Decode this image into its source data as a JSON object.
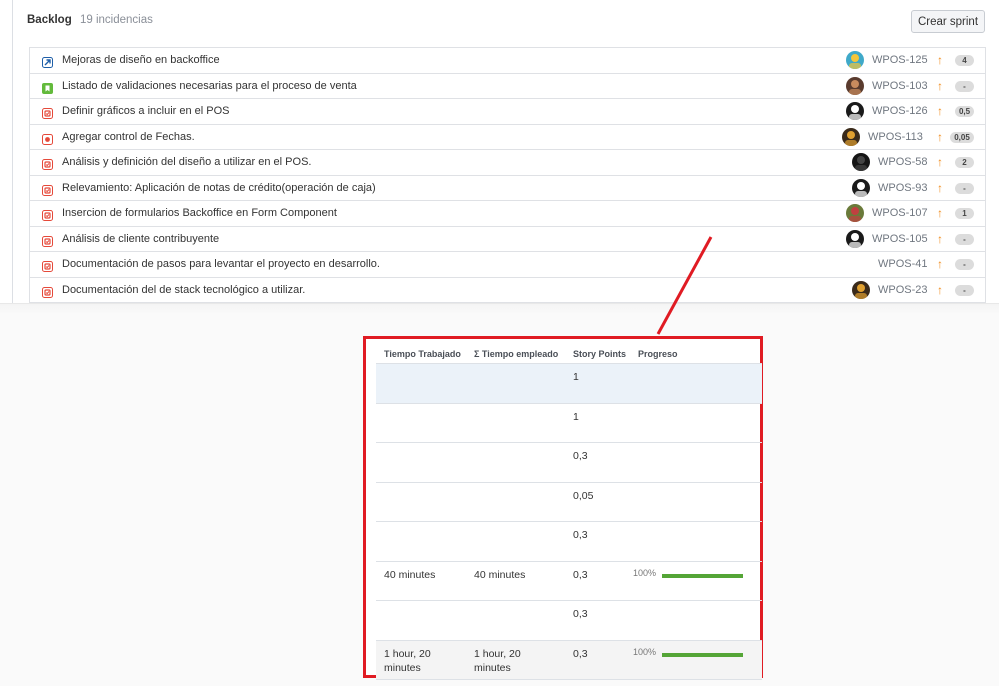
{
  "backlog": {
    "title": "Backlog",
    "count": "19 incidencias",
    "create_sprint_label": "Crear sprint"
  },
  "issues": [
    {
      "type": "improvement-icon",
      "summary": "Mejoras de diseño en backoffice",
      "key": "WPOS-125",
      "estimate": "4",
      "avatar_color": "#3fa9c9",
      "avatar_accent": "#f4c63a"
    },
    {
      "type": "story-icon",
      "summary": "Listado de validaciones necesarias para el proceso de venta",
      "key": "WPOS-103",
      "estimate": "-",
      "avatar_color": "#5a3b2e",
      "avatar_accent": "#c98b5e"
    },
    {
      "type": "task-icon",
      "summary": "Definir gráficos a incluir en el POS",
      "key": "WPOS-126",
      "estimate": "0,5",
      "avatar_color": "#1a1a1a",
      "avatar_accent": "#ffffff"
    },
    {
      "type": "bug-icon",
      "summary": "Agregar control de Fechas.",
      "key": "WPOS-113",
      "estimate": "0,05",
      "avatar_color": "#3a2a1a",
      "avatar_accent": "#e0a030"
    },
    {
      "type": "task-icon",
      "summary": "Análisis y definición del diseño a utilizar en el POS.",
      "key": "WPOS-58",
      "estimate": "2",
      "avatar_color": "#151515",
      "avatar_accent": "#444444"
    },
    {
      "type": "task-icon",
      "summary": "Relevamiento: Aplicación de notas de crédito(operación de caja)",
      "key": "WPOS-93",
      "estimate": "-",
      "avatar_color": "#1a1a1a",
      "avatar_accent": "#ffffff"
    },
    {
      "type": "task-icon",
      "summary": "Insercion de formularios Backoffice en Form Component",
      "key": "WPOS-107",
      "estimate": "1",
      "avatar_color": "#6a7a3a",
      "avatar_accent": "#c04040"
    },
    {
      "type": "task-icon",
      "summary": "Análisis de cliente contribuyente",
      "key": "WPOS-105",
      "estimate": "-",
      "avatar_color": "#1a1a1a",
      "avatar_accent": "#ffffff"
    },
    {
      "type": "task-icon",
      "summary": "Documentación de pasos para levantar el proyecto en desarrollo.",
      "key": "WPOS-41",
      "estimate": "-",
      "avatar_color": "",
      "avatar_accent": ""
    },
    {
      "type": "task-icon",
      "summary": "Documentación del de stack tecnológico a utilizar.",
      "key": "WPOS-23",
      "estimate": "-",
      "avatar_color": "#3a2a1a",
      "avatar_accent": "#e0a030"
    }
  ],
  "colors": {
    "priority_arrow": "#f08c1d",
    "highlight_border": "#e01b23",
    "progress_bar": "#54a536",
    "selected_row": "#ebf2f9"
  },
  "zoom_table": {
    "headers": [
      "Tiempo Trabajado",
      "Σ Tiempo empleado",
      "Story Points",
      "Progreso"
    ],
    "rows": [
      {
        "worked": "",
        "spent": "",
        "points": "1",
        "progress": "",
        "progress_value": null
      },
      {
        "worked": "",
        "spent": "",
        "points": "1",
        "progress": "",
        "progress_value": null
      },
      {
        "worked": "",
        "spent": "",
        "points": "0,3",
        "progress": "",
        "progress_value": null
      },
      {
        "worked": "",
        "spent": "",
        "points": "0,05",
        "progress": "",
        "progress_value": null
      },
      {
        "worked": "",
        "spent": "",
        "points": "0,3",
        "progress": "",
        "progress_value": null
      },
      {
        "worked": "40 minutes",
        "spent": "40 minutes",
        "points": "0,3",
        "progress": "100%",
        "progress_value": 1.0
      },
      {
        "worked": "",
        "spent": "",
        "points": "0,3",
        "progress": "",
        "progress_value": null
      },
      {
        "worked": "1 hour, 20 minutes",
        "spent": "1 hour, 20 minutes",
        "points": "0,3",
        "progress": "100%",
        "progress_value": 1.0
      }
    ]
  }
}
